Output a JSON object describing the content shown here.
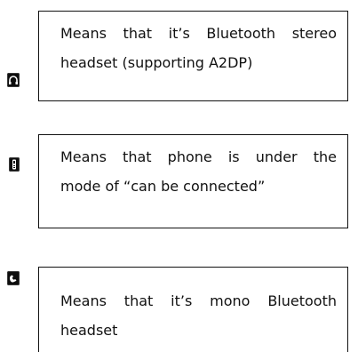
{
  "entries": [
    {
      "icon": "headphones-icon",
      "lines": [
        "Means that it’s Bluetooth stereo",
        "headset (supporting A2DP)"
      ]
    },
    {
      "icon": "mobile-phone-icon",
      "lines": [
        "Means that phone is under the",
        "mode of “can be connected”"
      ]
    },
    {
      "icon": "phone-handset-icon",
      "lines": [
        "Means that it’s mono Bluetooth",
        "headset"
      ]
    }
  ]
}
